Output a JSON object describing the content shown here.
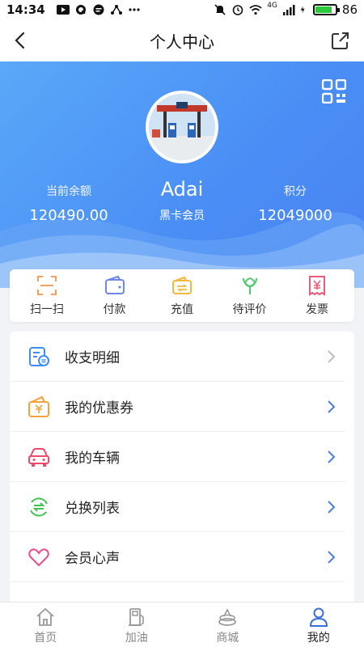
{
  "status_bar": {
    "time": "14:34",
    "battery": "86",
    "battery_fraction": 0.86,
    "network": "4G"
  },
  "header": {
    "title": "个人中心"
  },
  "profile": {
    "name": "Adai",
    "level": "黑卡会员",
    "balance_label": "当前余额",
    "balance_value": "120490.00",
    "points_label": "积分",
    "points_value": "12049000"
  },
  "quick_actions": [
    {
      "label": "扫一扫",
      "icon": "scan-icon",
      "color": "#f5a05a"
    },
    {
      "label": "付款",
      "icon": "wallet-icon",
      "color": "#6e86e8"
    },
    {
      "label": "充值",
      "icon": "recharge-icon",
      "color": "#f5b63c"
    },
    {
      "label": "待评价",
      "icon": "flower-icon",
      "color": "#4fc96a"
    },
    {
      "label": "发票",
      "icon": "invoice-icon",
      "color": "#ee5a7a"
    }
  ],
  "menu": [
    {
      "label": "收支明细",
      "icon": "bill-detail-icon",
      "color": "#3b8ef5"
    },
    {
      "label": "我的优惠券",
      "icon": "coupon-icon",
      "color": "#f5a23c"
    },
    {
      "label": "我的车辆",
      "icon": "car-icon",
      "color": "#ee4a6a"
    },
    {
      "label": "兑换列表",
      "icon": "exchange-icon",
      "color": "#3fc34f"
    },
    {
      "label": "会员心声",
      "icon": "heart-icon",
      "color": "#ee4a8a"
    }
  ],
  "tabs": [
    {
      "label": "首页",
      "icon": "home-icon",
      "active": false
    },
    {
      "label": "加油",
      "icon": "fuel-pump-icon",
      "active": false
    },
    {
      "label": "商城",
      "icon": "mall-icon",
      "active": false
    },
    {
      "label": "我的",
      "icon": "user-icon",
      "active": true
    }
  ],
  "colors": {
    "accent": "#4a8df5",
    "chevron_active": "#4a7ee0",
    "chevron_muted": "#b8bcc6"
  }
}
